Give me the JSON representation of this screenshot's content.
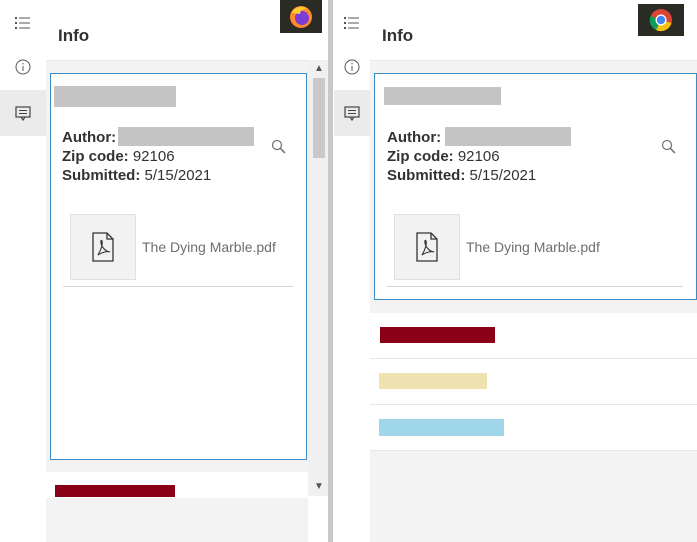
{
  "panels": [
    {
      "browser": "firefox",
      "header_title": "Info",
      "card": {
        "author_label": "Author:",
        "zip_label": "Zip code:",
        "zip_value": "92106",
        "submitted_label": "Submitted:",
        "submitted_value": "5/15/2021",
        "attachment_name": "The Dying Marble.pdf"
      },
      "swatches": [
        {
          "color": "#8a0017"
        }
      ]
    },
    {
      "browser": "chrome",
      "header_title": "Info",
      "card": {
        "author_label": "Author:",
        "zip_label": "Zip code:",
        "zip_value": "92106",
        "submitted_label": "Submitted:",
        "submitted_value": "5/15/2021",
        "attachment_name": "The Dying Marble.pdf"
      },
      "swatches": [
        {
          "color": "#8a0017"
        },
        {
          "color": "#efe2b1"
        },
        {
          "color": "#9fd6ea"
        }
      ]
    }
  ],
  "icons": {
    "rail": [
      "list-icon",
      "info-icon",
      "popup-icon"
    ],
    "zoom": "zoom-to-icon",
    "attachment": "pdf-icon"
  },
  "colors": {
    "accent_border": "#3a8cc6",
    "redaction": "#c4c4c4"
  }
}
